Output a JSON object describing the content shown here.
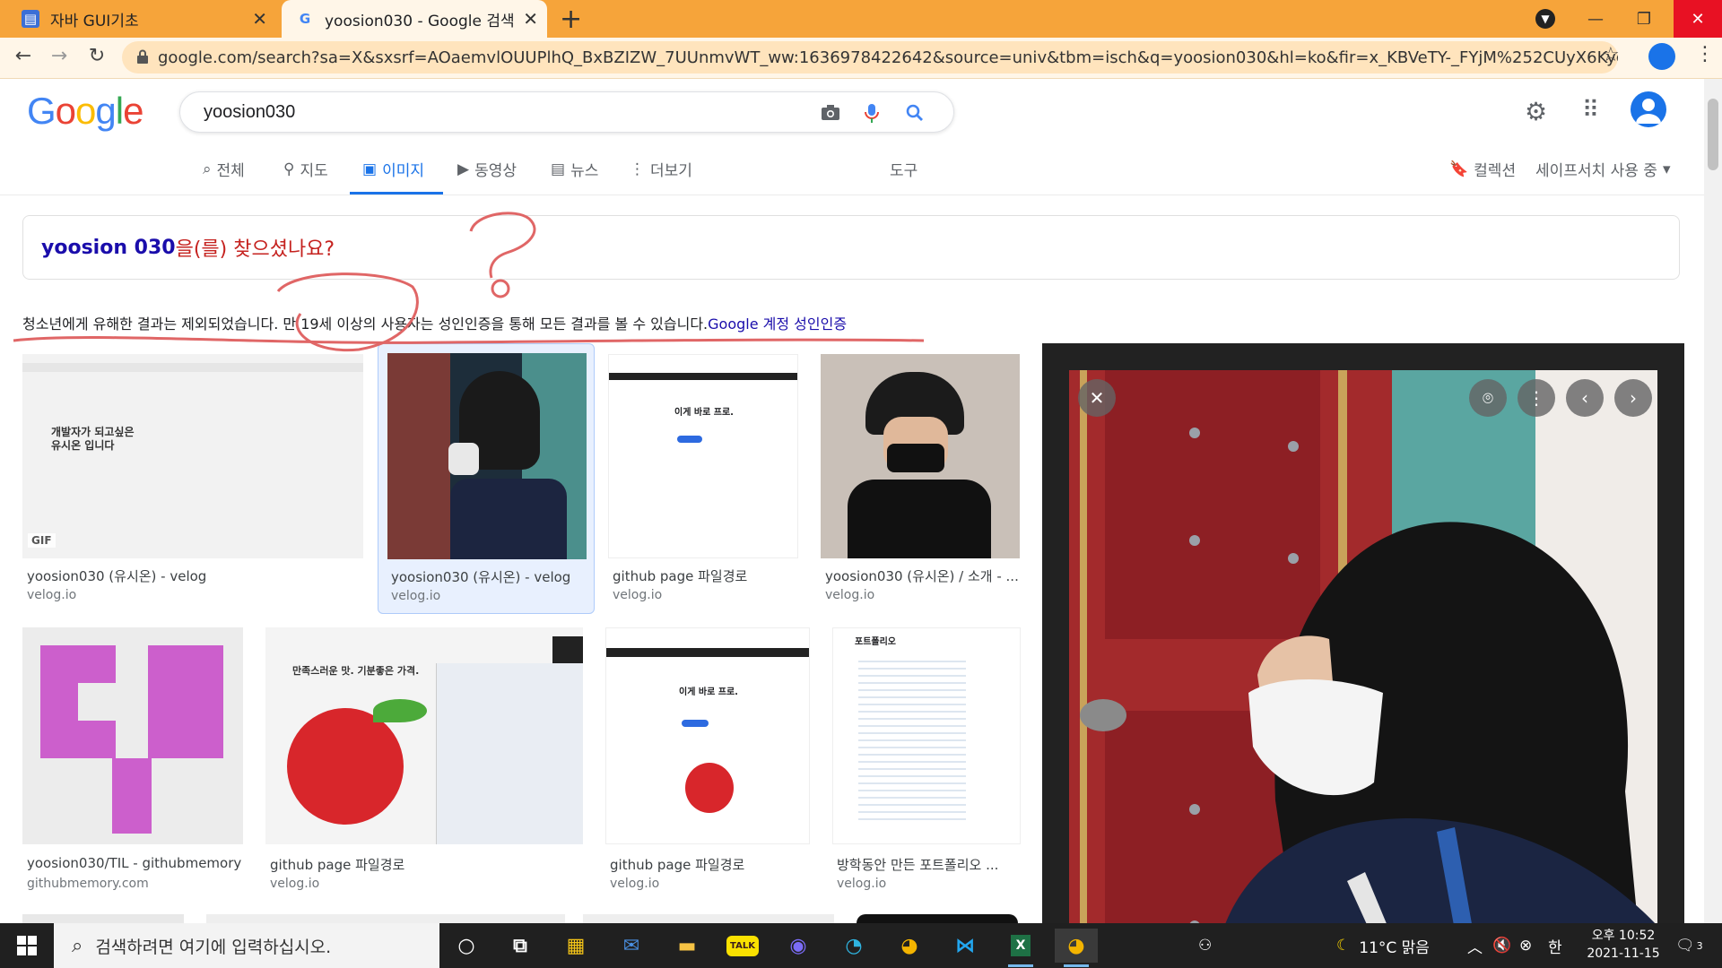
{
  "browser": {
    "tabs": [
      {
        "title": "자바 GUI기초",
        "active": false
      },
      {
        "title": "yoosion030 - Google 검색",
        "active": true
      }
    ],
    "url": "google.com/search?sa=X&sxsrf=AOaemvlOUUPlhQ_BxBZIZW_7UUnmvWT_ww:1636978422642&source=univ&tbm=isch&q=yoosion030&hl=ko&fir=x_KBVeTY-_FYjM%252CUyX6KydyszA8TM%252C_%..."
  },
  "google": {
    "logo": [
      "G",
      "o",
      "o",
      "g",
      "l",
      "e"
    ],
    "logo_colors": [
      "#4285f4",
      "#ea4335",
      "#fbbc05",
      "#4285f4",
      "#34a853",
      "#ea4335"
    ],
    "query": "yoosion030",
    "nav_tabs": [
      {
        "label": "전체",
        "icon": "search-icon"
      },
      {
        "label": "지도",
        "icon": "map-pin-icon"
      },
      {
        "label": "이미지",
        "icon": "image-icon"
      },
      {
        "label": "동영상",
        "icon": "video-icon"
      },
      {
        "label": "뉴스",
        "icon": "news-icon"
      },
      {
        "label": "더보기",
        "icon": "more-vert-icon"
      }
    ],
    "tools_label": "도구",
    "collections_label": "컬렉션",
    "safesearch_label": "세이프서치 사용 중"
  },
  "did_you_mean": {
    "suggestion": "yoosion 030",
    "rest": "을(를) 찾으셨나요?"
  },
  "safe_notice": {
    "text": "청소년에게 유해한 결과는 제외되었습니다. 만 19세 이상의 사용자는 성인인증을 통해 모든 결과를 볼 수 있습니다.",
    "link": "Google 계정 성인인증"
  },
  "results": [
    {
      "title": "yoosion030 (유시온) - velog",
      "site": "velog.io",
      "badge": "GIF",
      "caption": "개발자가 되고싶은\n유시온 입니다"
    },
    {
      "title": "yoosion030 (유시온) - velog",
      "site": "velog.io"
    },
    {
      "title": "github page 파일경로",
      "site": "velog.io",
      "caption": "이게 바로 프로."
    },
    {
      "title": "yoosion030 (유시온) / 소개 - ...",
      "site": "velog.io"
    },
    {
      "title": "yoosion030/TIL - githubmemory",
      "site": "githubmemory.com"
    },
    {
      "title": "github page 파일경로",
      "site": "velog.io",
      "caption": "만족스러운 맛. 기분좋은 가격."
    },
    {
      "title": "github page 파일경로",
      "site": "velog.io",
      "caption": "이게 바로 프로."
    },
    {
      "title": "방학동안 만든 포트폴리오 ...",
      "site": "velog.io",
      "caption": "포트폴리오"
    }
  ],
  "taskbar": {
    "search_placeholder": "검색하려면 여기에 입력하십시오.",
    "weather": "11°C 맑음",
    "ime": "한",
    "time": "오후 10:52",
    "date": "2021-11-15",
    "notifications": "3"
  }
}
